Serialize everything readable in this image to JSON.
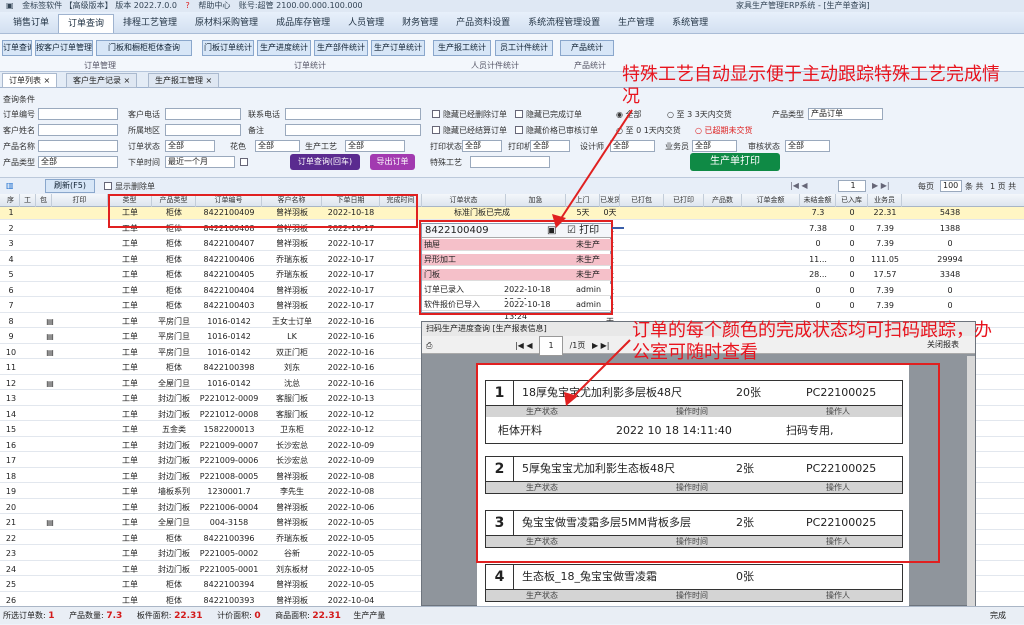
{
  "app": {
    "title": "金标签软件 【高级版本】 版本 2022.7.0.0",
    "help": "帮助中心",
    "user": "账号:超管 2100.00.000.100.000",
    "window_title": "家具生产管理ERP系统 - [生产单查询]"
  },
  "menus": [
    "销售订单",
    "订单查询",
    "排程工艺管理",
    "原材料采购管理",
    "成品库存管理",
    "人员管理",
    "财务管理",
    "产品资料设置",
    "系统流程管理设置",
    "生产管理",
    "系统管理"
  ],
  "active_menu": 1,
  "ribbon": {
    "buttons": [
      "订单查询",
      "按客户订单管理",
      "门板和橱柜柜体查询",
      "门板订单统计",
      "生产进度统计",
      "生产部件统计",
      "生产订单统计",
      "生产报工统计",
      "员工计件统计",
      "产品统计"
    ],
    "groups": [
      "订单管理",
      "订单统计",
      "人员计件统计",
      "产品统计"
    ]
  },
  "tabs": [
    "订单列表",
    "客户生产记录",
    "生产报工管理"
  ],
  "filter": {
    "section": "查询条件",
    "labels": {
      "order_no": "订单编号",
      "customer_phone": "客户电话",
      "contact_phone": "联系电话",
      "customer_name": "客户姓名",
      "customer_addr": "所属地区",
      "remark": "备注",
      "product_name": "产品名称",
      "order_type": "订单状态",
      "color": "花色",
      "process": "生产工艺",
      "unprinted": "打印状态",
      "printed": "打印机",
      "designer": "设计师",
      "salesman": "业务员",
      "order_kind": "订单类型",
      "stock": "审核状态",
      "product_kind": "产品类型",
      "batch": "批次",
      "dept": "部门",
      "date_type": "下单时间"
    },
    "values": {
      "order_type": "全部",
      "color": "全部",
      "process": "全部",
      "unprinted": "全部",
      "printed": "全部",
      "designer": "全部",
      "salesman": "全部",
      "order_kind": "全部",
      "stock": "全部",
      "dept": "全部",
      "date_type": "最近一个月",
      "product_type": "产品订单"
    },
    "checks": [
      "隐藏已经删除订单",
      "隐藏已完成订单",
      "隐藏已经结算订单",
      "隐藏价格已审核订单"
    ],
    "radios": {
      "all": "全部",
      "due3": "3天内交货",
      "due1": "1天内交货",
      "overdue": "已超期未交货",
      "option_a": "至",
      "option_b": "至"
    },
    "delivery_label": "交货日期",
    "special_process_label": "特殊工艺",
    "btn_query": "订单查询(回车)",
    "btn_order": "导出订单",
    "btn_print": "生产单打印"
  },
  "toolbar": {
    "refresh": "刷新(F5)",
    "show_deleted": "显示删除单",
    "page": "1",
    "per_page_label": "每页",
    "per_page": "100",
    "total_rows": "条 共",
    "total_pages": "1 页 共"
  },
  "columns": [
    "序",
    "工",
    "包",
    "打印",
    "类型",
    "产品类型",
    "订单编号",
    "客户名称",
    "下单日期",
    "完成时间",
    "订单状态",
    "加急",
    "上门",
    "已发货/数",
    "已打包",
    "已打印",
    "产品数",
    "订单金额",
    "未结金额",
    "已入库",
    "业务员"
  ],
  "rows": [
    [
      "1",
      "工单",
      "柜体",
      "8422100409",
      "曾祥羽板",
      "2022-10-18",
      "",
      "标准门板已完成",
      "5天",
      "0天",
      "",
      "",
      "",
      "7.3",
      "0",
      "22.31",
      "5438"
    ],
    [
      "2",
      "工单",
      "柜体",
      "8422100408",
      "曾祥羽板",
      "2022-10-17",
      "",
      "",
      "",
      "天",
      "",
      "",
      "",
      "7.38",
      "0",
      "7.39",
      "1388"
    ],
    [
      "3",
      "工单",
      "柜体",
      "8422100407",
      "曾祥羽板",
      "2022-10-17",
      "",
      "",
      "",
      "天",
      "",
      "",
      "",
      "0",
      "0",
      "7.39",
      "0"
    ],
    [
      "4",
      "工单",
      "柜体",
      "8422100406",
      "乔瑞东板",
      "2022-10-17",
      "",
      "",
      "",
      "天",
      "",
      "",
      "",
      "11...",
      "0",
      "111.05",
      "29994"
    ],
    [
      "5",
      "工单",
      "柜体",
      "8422100405",
      "乔瑞东板",
      "2022-10-17",
      "",
      "",
      "",
      "天",
      "",
      "",
      "",
      "28...",
      "0",
      "17.57",
      "3348"
    ],
    [
      "6",
      "工单",
      "柜体",
      "8422100404",
      "曾祥羽板",
      "2022-10-17",
      "",
      "",
      "",
      "天",
      "",
      "",
      "",
      "0",
      "0",
      "7.39",
      "0"
    ],
    [
      "7",
      "工单",
      "柜体",
      "8422100403",
      "曾祥羽板",
      "2022-10-17",
      "",
      "",
      "",
      "天",
      "",
      "",
      "",
      "0",
      "0",
      "7.39",
      "0"
    ],
    [
      "8",
      "工单",
      "平房门旦",
      "1016-0142",
      "王女士订单",
      "2022-10-16",
      "",
      "",
      "",
      "天",
      "",
      "",
      "",
      "",
      "",
      "",
      ""
    ],
    [
      "9",
      "工单",
      "平房门旦",
      "1016-0142",
      "LK",
      "2022-10-16",
      "",
      "",
      "",
      "天",
      "",
      "",
      "",
      "",
      "",
      "",
      ""
    ],
    [
      "10",
      "工单",
      "平房门旦",
      "1016-0142",
      "双正门柜",
      "2022-10-16",
      "",
      "",
      "",
      "天",
      "",
      "",
      "",
      "",
      "",
      "",
      ""
    ],
    [
      "11",
      "工单",
      "柜体",
      "8422100398",
      "刘东",
      "2022-10-16",
      "",
      "",
      "",
      "天",
      "",
      "",
      "",
      "",
      "",
      "",
      ""
    ],
    [
      "12",
      "工单",
      "全屋门旦",
      "1016-0142",
      "沈总",
      "2022-10-16",
      "",
      "",
      "",
      "天",
      "",
      "",
      "",
      "",
      "",
      "",
      ""
    ],
    [
      "13",
      "工单",
      "封边门板",
      "P221012-0009",
      "客服门板",
      "2022-10-13",
      "",
      "",
      "",
      "天",
      "",
      "",
      "",
      "",
      "",
      "",
      ""
    ],
    [
      "14",
      "工单",
      "封边门板",
      "P221012-0008",
      "客服门板",
      "2022-10-12",
      "",
      "",
      "",
      "天",
      "",
      "",
      "",
      "",
      "",
      "",
      ""
    ],
    [
      "15",
      "工单",
      "五金类",
      "1582200013",
      "卫东柜",
      "2022-10-12",
      "",
      "",
      "",
      "天",
      "",
      "",
      "",
      "",
      "",
      "",
      ""
    ],
    [
      "16",
      "工单",
      "封边门板",
      "P221009-0007",
      "长沙宏总",
      "2022-10-09",
      "",
      "",
      "",
      "天",
      "",
      "",
      "",
      "",
      "",
      "",
      ""
    ],
    [
      "17",
      "工单",
      "封边门板",
      "P221009-0006",
      "长沙宏总",
      "2022-10-09",
      "",
      "",
      "",
      "天",
      "",
      "",
      "",
      "",
      "",
      "",
      ""
    ],
    [
      "18",
      "工单",
      "封边门板",
      "P221008-0005",
      "曾祥羽板",
      "2022-10-08",
      "",
      "",
      "",
      "天",
      "",
      "",
      "",
      "",
      "",
      "",
      ""
    ],
    [
      "19",
      "工单",
      "墙板系列",
      "1230001.7",
      "李先生",
      "2022-10-08",
      "",
      "",
      "",
      "天",
      "",
      "",
      "",
      "",
      "",
      "",
      ""
    ],
    [
      "20",
      "工单",
      "封边门板",
      "P221006-0004",
      "曾祥羽板",
      "2022-10-06",
      "",
      "",
      "",
      "天",
      "",
      "",
      "",
      "",
      "",
      "",
      ""
    ],
    [
      "21",
      "工单",
      "全屋门旦",
      "004-3158",
      "曾祥羽板",
      "2022-10-05",
      "",
      "",
      "",
      "天",
      "",
      "",
      "",
      "",
      "",
      "",
      ""
    ],
    [
      "22",
      "工单",
      "柜体",
      "8422100396",
      "乔瑞东板",
      "2022-10-05",
      "",
      "",
      "",
      "天",
      "",
      "",
      "",
      "",
      "",
      "",
      ""
    ],
    [
      "23",
      "工单",
      "封边门板",
      "P221005-0002",
      "谷新",
      "2022-10-05",
      "",
      "",
      "",
      "天",
      "",
      "",
      "",
      "",
      "",
      "",
      ""
    ],
    [
      "24",
      "工单",
      "封边门板",
      "P221005-0001",
      "刘东板材",
      "2022-10-05",
      "",
      "",
      "",
      "天",
      "",
      "",
      "",
      "",
      "",
      "",
      ""
    ],
    [
      "25",
      "工单",
      "柜体",
      "8422100394",
      "曾祥羽板",
      "2022-10-05",
      "",
      "",
      "",
      "天",
      "",
      "",
      "",
      "",
      "",
      "",
      ""
    ],
    [
      "26",
      "工单",
      "柜体",
      "8422100393",
      "曾祥羽板",
      "2022-10-04",
      "",
      "",
      "",
      "天",
      "",
      "",
      "",
      "",
      "",
      "",
      ""
    ]
  ],
  "popup": {
    "order_no": "8422100409",
    "check_label": "打印",
    "rows": [
      [
        "抽屉",
        "",
        "未生产"
      ],
      [
        "异形加工",
        "",
        "未生产"
      ],
      [
        "门板",
        "",
        "未生产"
      ],
      [
        "订单已录入",
        "2022-10-18 13:24",
        "admin"
      ],
      [
        "软件报价已导入",
        "2022-10-18 13:24",
        "admin"
      ]
    ]
  },
  "preview": {
    "title": "扫码生产进度查询 [生产报表信息]",
    "toolbar_page": "1",
    "toolbar_of": "/1页",
    "close": "关闭报表",
    "blocks": [
      {
        "n": "1",
        "name": "18厚兔宝宝尤加利影多层板48尺",
        "qty": "20张",
        "code": "PC22100025"
      },
      {
        "n": "2",
        "name": "5厚兔宝宝尤加利影生态板48尺",
        "qty": "2张",
        "code": "PC22100025"
      },
      {
        "n": "3",
        "name": "兔宝宝做雪凌霜多层5MM背板多层",
        "qty": "2张",
        "code": "PC22100025"
      },
      {
        "n": "4",
        "name": "生态板_18_兔宝宝做雪凌霜",
        "qty": "0张",
        "code": ""
      }
    ],
    "sub": [
      "生产状态",
      "操作时间",
      "操作人"
    ],
    "scan": {
      "status": "柜体开料",
      "time": "2022 10 18 14:11:40",
      "by": "扫码专用,"
    }
  },
  "status": {
    "total_orders_label": "所选订单数:",
    "total_orders": "1",
    "area_label": "产品数量:",
    "area": "7.3",
    "panel_label": "板件面积:",
    "panel": "22.31",
    "calc_label": "计价面积:",
    "calc": "0",
    "rate_label": "商品面积:",
    "rate": "22.31",
    "prod_label": "生产产量",
    "hidden_label": "上生产汇总(图)",
    "done_label": "完成"
  },
  "annotations": {
    "top": "特殊工艺自动显示便于主动跟踪特殊工艺完成情况",
    "middle": "订单的每个颜色的完成状态均可扫码跟踪，办公室可随时查看"
  },
  "colors": {
    "accent": "#e02020",
    "selected_row": "#fff6c4",
    "popup_pink": "#f5c0c9",
    "btn_purple": "#7a2e9e",
    "btn_green": "#0f8a45"
  }
}
